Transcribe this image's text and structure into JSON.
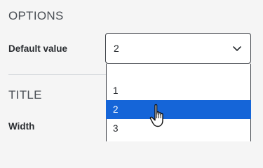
{
  "options_section": {
    "title": "OPTIONS",
    "default_value_label": "Default value",
    "select": {
      "value": "2",
      "options": [
        "",
        "1",
        "2",
        "3"
      ],
      "highlighted": "2"
    }
  },
  "title_section": {
    "title": "TITLE",
    "width_label": "Width"
  },
  "colors": {
    "accent": "#1565d8",
    "background": "#f5f5f5",
    "border": "#3f4349"
  },
  "icons": {
    "select_chevron": "chevron-down-icon",
    "cursor": "hand-pointer-cursor-icon"
  }
}
